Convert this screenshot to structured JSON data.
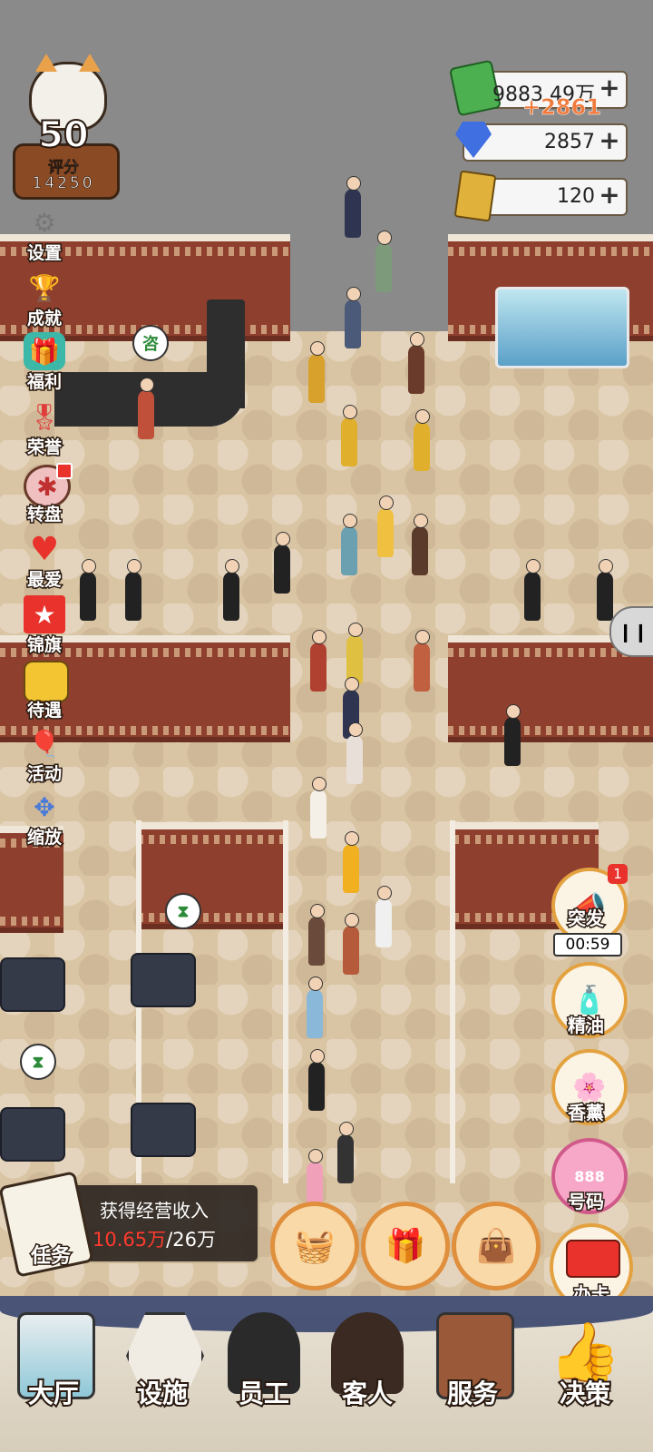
{
  "rating": {
    "level": "50",
    "label": "评分",
    "score": "14250"
  },
  "resources": [
    {
      "name": "cash",
      "value": "9883.49万",
      "icon": "cash-icon",
      "color": "#4caf50"
    },
    {
      "name": "diamond",
      "value": "2857",
      "icon": "diamond-icon",
      "color": "#3f6fe0"
    },
    {
      "name": "card",
      "value": "120",
      "icon": "gold-card-icon",
      "color": "#e0b23c"
    }
  ],
  "income_popup": "+2861",
  "side_menu": [
    {
      "label": "设置",
      "icon": "gear-icon",
      "badge": false
    },
    {
      "label": "成就",
      "icon": "trophy-icon",
      "badge": false
    },
    {
      "label": "福利",
      "icon": "gift-icon",
      "badge": false
    },
    {
      "label": "荣誉",
      "icon": "medal-icon",
      "badge": false
    },
    {
      "label": "转盘",
      "icon": "wheel-icon",
      "badge": true
    },
    {
      "label": "最爱",
      "icon": "heart-icon",
      "badge": false
    },
    {
      "label": "锦旗",
      "icon": "banner-icon",
      "badge": false
    },
    {
      "label": "待遇",
      "icon": "folder-icon",
      "badge": false
    },
    {
      "label": "活动",
      "icon": "balloon-icon",
      "badge": false
    },
    {
      "label": "缩放",
      "icon": "zoom-arrows-icon",
      "badge": false
    }
  ],
  "right_menu": {
    "event": {
      "label": "突发",
      "timer": "00:59",
      "badge": "1"
    },
    "oil": {
      "label": "精油"
    },
    "incense": {
      "label": "香薰"
    },
    "number": {
      "label": "号码",
      "badge_text": "888"
    },
    "card": {
      "label": "办卡"
    }
  },
  "task": {
    "label": "任务",
    "title": "获得经营收入",
    "current": "10.65万",
    "target": "/26万"
  },
  "bottom_nav": [
    {
      "label": "大厅",
      "icon": "hall-icon"
    },
    {
      "label": "设施",
      "icon": "facility-icon"
    },
    {
      "label": "员工",
      "icon": "staff-icon"
    },
    {
      "label": "客人",
      "icon": "guest-icon"
    },
    {
      "label": "服务",
      "icon": "service-icon"
    },
    {
      "label": "决策",
      "icon": "thumbs-up-icon"
    }
  ],
  "reception_bubble": "咨",
  "colors": {
    "wall": "#8e3f2e",
    "accent": "#e3a23f",
    "badge": "#e8322b",
    "task_highlight": "#ff3a2e"
  }
}
